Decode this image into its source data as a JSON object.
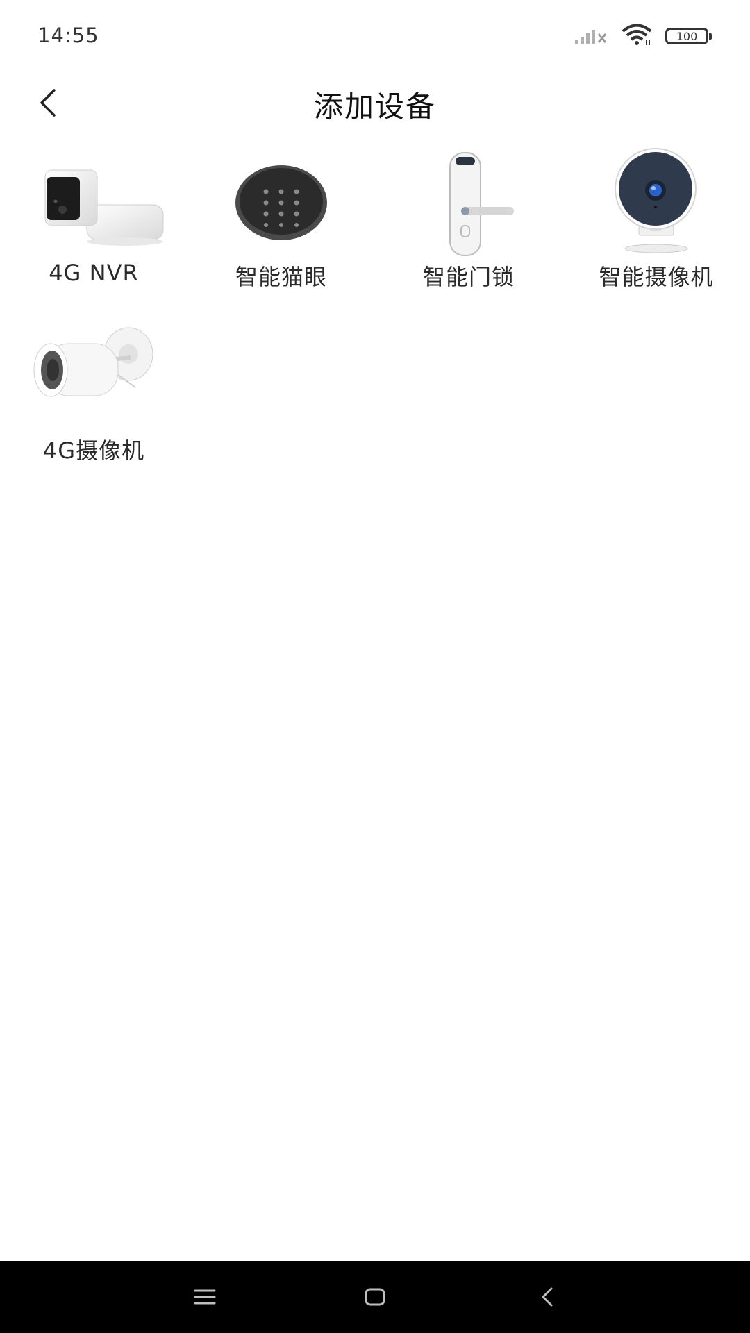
{
  "status_bar": {
    "time": "14:55",
    "battery_level": "100",
    "icons": [
      "signal-no-service-icon",
      "wifi-icon",
      "battery-icon"
    ]
  },
  "header": {
    "title": "添加设备",
    "back_icon": "chevron-left-icon"
  },
  "devices": [
    {
      "label": "4G NVR",
      "icon": "nvr-camera-hub-image"
    },
    {
      "label": "智能猫眼",
      "icon": "smart-peephole-image"
    },
    {
      "label": "智能门锁",
      "icon": "smart-door-lock-image"
    },
    {
      "label": "智能摄像机",
      "icon": "smart-camera-image"
    },
    {
      "label": "4G摄像机",
      "icon": "4g-bullet-camera-image"
    }
  ],
  "nav_bar": {
    "icons": [
      "menu-icon",
      "home-icon",
      "back-icon"
    ]
  },
  "colors": {
    "background": "#ffffff",
    "nav_bar": "#000000",
    "text": "#222222"
  }
}
